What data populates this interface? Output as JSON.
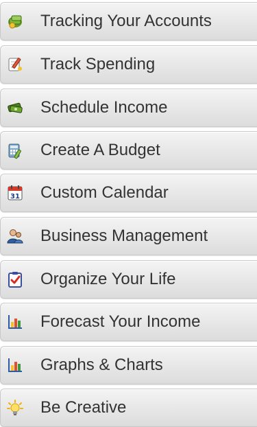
{
  "menu": {
    "items": [
      {
        "label": "Tracking Your Accounts",
        "icon": "money-stack-icon"
      },
      {
        "label": "Track Spending",
        "icon": "notepad-pen-icon"
      },
      {
        "label": "Schedule Income",
        "icon": "money-bills-icon"
      },
      {
        "label": "Create A Budget",
        "icon": "calculator-pencil-icon"
      },
      {
        "label": "Custom Calendar",
        "icon": "calendar-31-icon"
      },
      {
        "label": "Business Management",
        "icon": "business-user-icon"
      },
      {
        "label": "Organize Your Life",
        "icon": "checklist-clipboard-icon"
      },
      {
        "label": "Forecast Your Income",
        "icon": "bar-chart-icon"
      },
      {
        "label": "Graphs & Charts",
        "icon": "bar-chart-icon"
      },
      {
        "label": "Be Creative",
        "icon": "lightbulb-icon"
      }
    ]
  },
  "colors": {
    "text": "#333333",
    "tab_top": "#f4f4f4",
    "tab_bottom": "#dcdcdc",
    "tab_border": "#c9c9c9"
  }
}
